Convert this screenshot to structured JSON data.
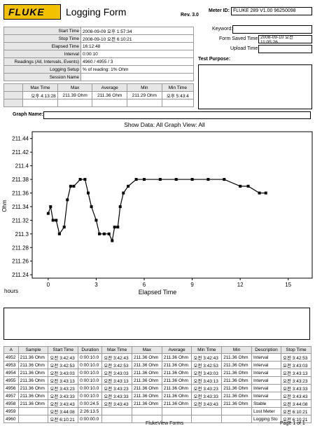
{
  "header": {
    "brand": "FLUKE",
    "title": "Logging Form",
    "rev": "Rev. 3.0",
    "meter_id_label": "Meter ID:",
    "meter_id_value": "FLUKE 289  V1.00  96250098",
    "keyword_label": "Keyword:",
    "form_saved_label": "Form Saved Time:",
    "form_saved_value": "2008-09-10 오전 11:05:26",
    "upload_label": "Upload Time:",
    "upload_value": "",
    "test_purpose_label": "Test Purpose:"
  },
  "info": [
    {
      "label": "Start Time",
      "value": "2008-09-09 오후 1:57:34"
    },
    {
      "label": "Stop Time",
      "value": "2008-09-10 오전 6:10:21"
    },
    {
      "label": "Elapsed Time",
      "value": "16:12:48"
    },
    {
      "label": "Interval",
      "value": "0:00:10"
    },
    {
      "label": "Readings (All, Intervals, Events)",
      "value": "4960 / 4955 / 3"
    },
    {
      "label": "Logging Setup",
      "value": "% of reading: 1% Ohm"
    },
    {
      "label": "Session Name",
      "value": ""
    }
  ],
  "summary": {
    "headers": [
      "Max Time",
      "Max",
      "Average",
      "Min",
      "Min Time"
    ],
    "values": [
      "오후 4:13:28",
      "211.39 Ohm",
      "211.36 Ohm",
      "211.29 Ohm",
      "오후 5:43:4"
    ]
  },
  "graph": {
    "name_label": "Graph Name:",
    "show_data_text": "Show Data: All   Graph View: All"
  },
  "chart_data": {
    "type": "line",
    "title": "",
    "xlabel": "Elapsed Time",
    "x_unit_label": "hours",
    "ylabel": "Ohm",
    "xlim": [
      -1,
      16.5
    ],
    "ylim": [
      211.235,
      211.45
    ],
    "x_ticks": [
      0,
      3,
      6,
      9,
      12,
      15
    ],
    "y_ticks": [
      211.24,
      211.26,
      211.28,
      211.3,
      211.32,
      211.34,
      211.36,
      211.38,
      211.4,
      211.42,
      211.44
    ],
    "grid": false,
    "series": [
      {
        "values": [
          {
            "x": 0.0,
            "y": 211.33
          },
          {
            "x": 0.15,
            "y": 211.34
          },
          {
            "x": 0.3,
            "y": 211.32
          },
          {
            "x": 0.5,
            "y": 211.32
          },
          {
            "x": 0.7,
            "y": 211.3
          },
          {
            "x": 1.0,
            "y": 211.31
          },
          {
            "x": 1.2,
            "y": 211.35
          },
          {
            "x": 1.4,
            "y": 211.37
          },
          {
            "x": 1.6,
            "y": 211.37
          },
          {
            "x": 2.0,
            "y": 211.38
          },
          {
            "x": 2.3,
            "y": 211.38
          },
          {
            "x": 2.5,
            "y": 211.36
          },
          {
            "x": 2.7,
            "y": 211.34
          },
          {
            "x": 3.0,
            "y": 211.32
          },
          {
            "x": 3.2,
            "y": 211.3
          },
          {
            "x": 3.5,
            "y": 211.3
          },
          {
            "x": 3.8,
            "y": 211.3
          },
          {
            "x": 4.0,
            "y": 211.29
          },
          {
            "x": 4.15,
            "y": 211.31
          },
          {
            "x": 4.35,
            "y": 211.31
          },
          {
            "x": 4.5,
            "y": 211.34
          },
          {
            "x": 4.7,
            "y": 211.36
          },
          {
            "x": 5.0,
            "y": 211.37
          },
          {
            "x": 5.5,
            "y": 211.38
          },
          {
            "x": 6.0,
            "y": 211.38
          },
          {
            "x": 7.0,
            "y": 211.38
          },
          {
            "x": 8.0,
            "y": 211.38
          },
          {
            "x": 9.0,
            "y": 211.38
          },
          {
            "x": 10.0,
            "y": 211.38
          },
          {
            "x": 11.0,
            "y": 211.38
          },
          {
            "x": 12.0,
            "y": 211.37
          },
          {
            "x": 12.5,
            "y": 211.37
          },
          {
            "x": 13.2,
            "y": 211.36
          },
          {
            "x": 13.6,
            "y": 211.36
          }
        ]
      }
    ]
  },
  "table": {
    "headers": [
      "A",
      "Sample",
      "Start Time",
      "Duration",
      "Max Time",
      "Max",
      "Average",
      "Min Time",
      "Min",
      "Description",
      "Stop Time"
    ],
    "rows": [
      [
        "4952",
        "211.36 Ohm",
        "오전 3:42:43",
        "0:00:10.0",
        "오전 3:42:43",
        "211.36 Ohm",
        "211.36 Ohm",
        "오전 3:42:43",
        "211.36 Ohm",
        "Interval",
        "오전 3:42:53"
      ],
      [
        "4953",
        "211.36 Ohm",
        "오전 3:42:53",
        "0:00:10.0",
        "오전 3:42:53",
        "211.36 Ohm",
        "211.36 Ohm",
        "오전 3:42:53",
        "211.36 Ohm",
        "Interval",
        "오전 3:43:03"
      ],
      [
        "4954",
        "211.36 Ohm",
        "오전 3:43:03",
        "0:00:10.0",
        "오전 3:43:03",
        "211.36 Ohm",
        "211.36 Ohm",
        "오전 3:43:03",
        "211.36 Ohm",
        "Interval",
        "오전 3:43:13"
      ],
      [
        "4955",
        "211.36 Ohm",
        "오전 3:43:13",
        "0:00:10.0",
        "오전 3:43:13",
        "211.36 Ohm",
        "211.36 Ohm",
        "오전 3:43:13",
        "211.36 Ohm",
        "Interval",
        "오전 3:43:23"
      ],
      [
        "4956",
        "211.36 Ohm",
        "오전 3:43:23",
        "0:00:10.0",
        "오전 3:43:23",
        "211.36 Ohm",
        "211.36 Ohm",
        "오전 3:43:23",
        "211.36 Ohm",
        "Interval",
        "오전 3:43:33"
      ],
      [
        "4957",
        "211.36 Ohm",
        "오전 3:43:33",
        "0:00:10.0",
        "오전 3:43:33",
        "211.36 Ohm",
        "211.36 Ohm",
        "오전 3:43:33",
        "211.36 Ohm",
        "Interval",
        "오전 3:43:43"
      ],
      [
        "4958",
        "211.36 Ohm",
        "오전 3:43:43",
        "0:00:24.5",
        "오전 3:43:43",
        "211.36 Ohm",
        "211.36 Ohm",
        "오전 3:43:43",
        "211.36 Ohm",
        "Stable",
        "오전 3:44:08"
      ],
      [
        "4959",
        "",
        "오전 3:44:08",
        "2:26:13.5",
        "",
        "",
        "",
        "",
        "",
        "Lost Meter",
        "오전 6:10:21"
      ],
      [
        "4960",
        "",
        "오전 6:10:21",
        "0:00:00.0",
        "",
        "",
        "",
        "",
        "",
        "Logging Sto",
        "오전 6:10:21"
      ]
    ]
  },
  "footer": {
    "center": "FlukeView Forms",
    "page": "Page 1 of 1"
  }
}
